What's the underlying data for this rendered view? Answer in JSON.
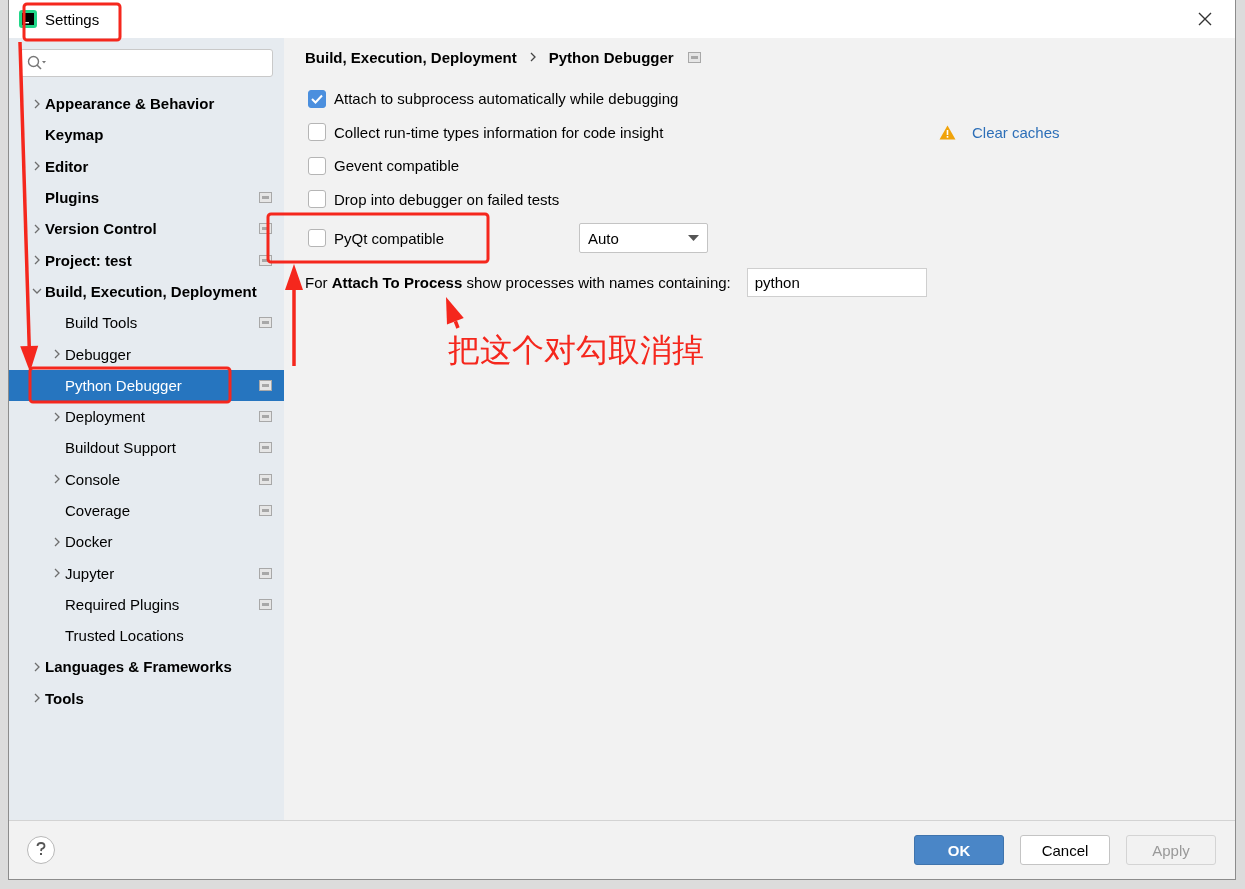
{
  "window": {
    "title": "Settings"
  },
  "tree": [
    {
      "label": "Appearance & Behavior",
      "expanded": false,
      "selected": false,
      "project_icon": false
    },
    {
      "label": "Keymap",
      "selected": false,
      "project_icon": false
    },
    {
      "label": "Editor",
      "expanded": false,
      "selected": false,
      "project_icon": false
    },
    {
      "label": "Plugins",
      "selected": false,
      "project_icon": true
    },
    {
      "label": "Version Control",
      "expanded": false,
      "selected": false,
      "project_icon": true
    },
    {
      "label": "Project: test",
      "expanded": false,
      "selected": false,
      "project_icon": true
    },
    {
      "label": "Build, Execution, Deployment",
      "expanded": true,
      "selected": false,
      "project_icon": false,
      "children": [
        {
          "label": "Build Tools",
          "selected": false,
          "project_icon": true
        },
        {
          "label": "Debugger",
          "expanded": false,
          "selected": false,
          "project_icon": false
        },
        {
          "label": "Python Debugger",
          "selected": true,
          "project_icon": true
        },
        {
          "label": "Deployment",
          "expanded": false,
          "selected": false,
          "project_icon": true
        },
        {
          "label": "Buildout Support",
          "selected": false,
          "project_icon": true
        },
        {
          "label": "Console",
          "expanded": false,
          "selected": false,
          "project_icon": true
        },
        {
          "label": "Coverage",
          "selected": false,
          "project_icon": true
        },
        {
          "label": "Docker",
          "expanded": false,
          "selected": false,
          "project_icon": false
        },
        {
          "label": "Jupyter",
          "expanded": false,
          "selected": false,
          "project_icon": true
        },
        {
          "label": "Required Plugins",
          "selected": false,
          "project_icon": true
        },
        {
          "label": "Trusted Locations",
          "selected": false,
          "project_icon": false
        }
      ]
    },
    {
      "label": "Languages & Frameworks",
      "expanded": false,
      "selected": false,
      "project_icon": false
    },
    {
      "label": "Tools",
      "expanded": false,
      "selected": false,
      "project_icon": false
    }
  ],
  "breadcrumb": [
    "Build, Execution, Deployment",
    "Python Debugger"
  ],
  "options": [
    {
      "kind": "checkbox",
      "label": "Attach to subprocess automatically while debugging",
      "checked": true
    },
    {
      "kind": "checkbox_link",
      "label": "Collect run-time types information for code insight",
      "checked": false,
      "link": "Clear caches"
    },
    {
      "kind": "checkbox",
      "label": "Gevent compatible",
      "checked": false
    },
    {
      "kind": "checkbox",
      "label": "Drop into debugger on failed tests",
      "checked": false
    },
    {
      "kind": "checkbox_dropdown",
      "label": "PyQt compatible",
      "checked": false,
      "value": "Auto"
    },
    {
      "kind": "text_field",
      "label": "For **Attach To Process** show processes with names containing:",
      "value": "python"
    }
  ],
  "buttons": [
    {
      "label": "OK",
      "kind": "default",
      "disabled": false
    },
    {
      "label": "Cancel",
      "kind": "normal",
      "disabled": false
    },
    {
      "label": "Apply",
      "kind": "normal",
      "disabled": true
    }
  ],
  "annotation": {
    "note": "把这个对勾取消掉"
  }
}
